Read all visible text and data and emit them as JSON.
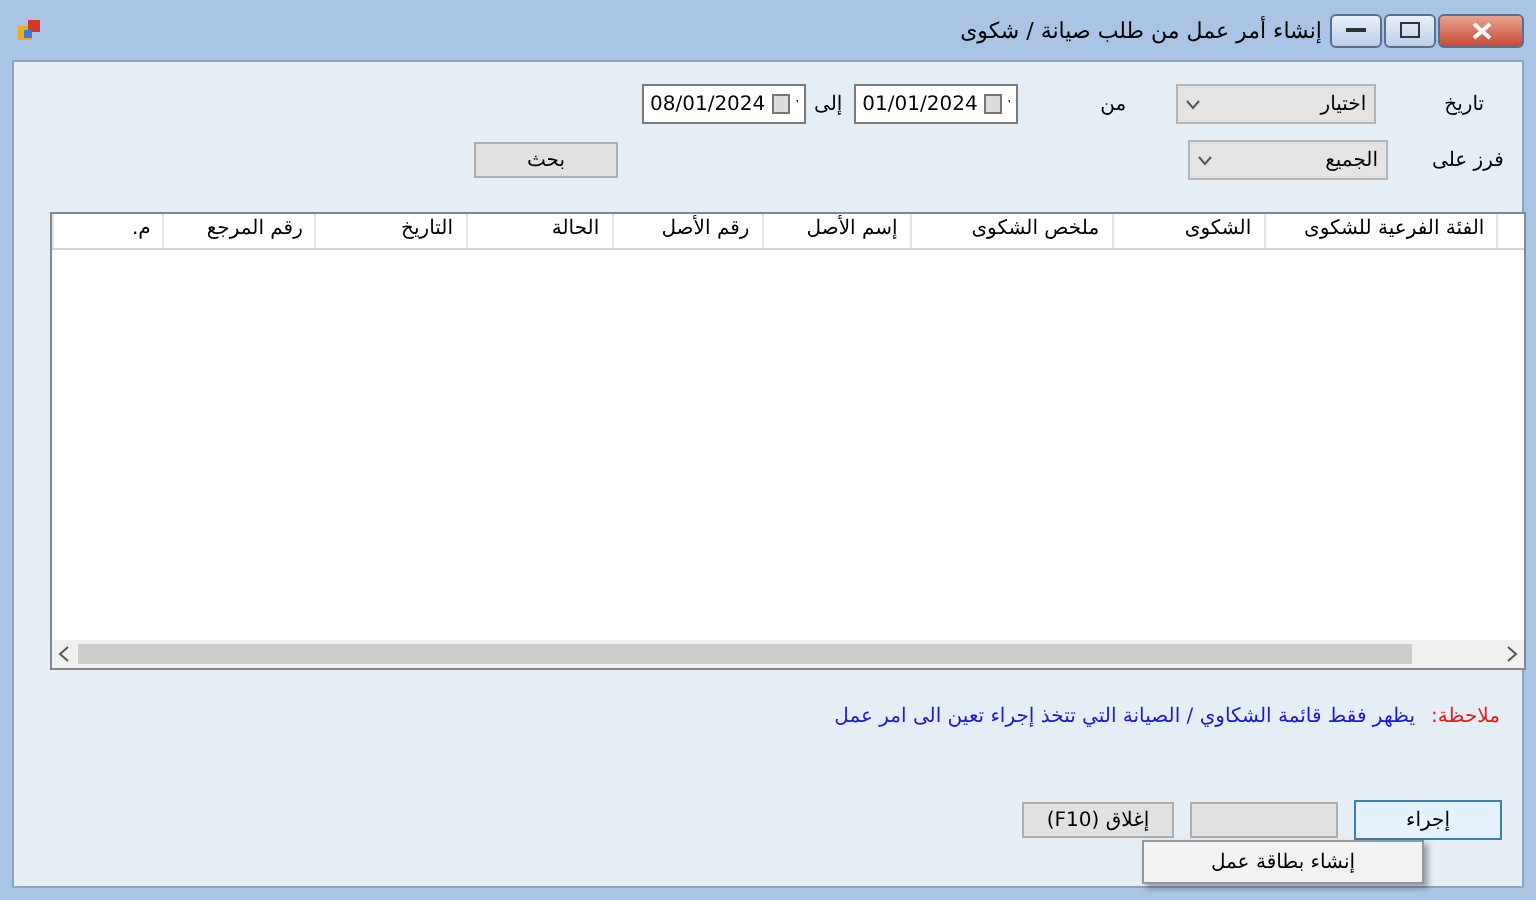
{
  "window": {
    "title": "إنشاء أمر عمل من طلب صيانة / شكوى"
  },
  "filters": {
    "date_label": "تاريخ",
    "date_choice": "اختيار",
    "from_label": "من",
    "from_date": "01/01/2024",
    "to_label": "إلى",
    "to_date": "08/01/2024",
    "sort_label": "فرز على",
    "sort_choice": "الجميع",
    "search_button": "بحث"
  },
  "table": {
    "columns": [
      "الفئة الفرعية للشكوى",
      "الشكوى",
      "ملخص الشكوى",
      "إسم الأصل",
      "رقم الأصل",
      "الحالة",
      "التاريخ",
      "رقم المرجع",
      "م."
    ]
  },
  "note": {
    "label": "ملاحظة:",
    "text": "يظهر فقط قائمة الشكاوي / الصيانة التي تتخذ إجراء تعين الى امر عمل"
  },
  "buttons": [
    {
      "label": "إجراء",
      "focused": true
    },
    {
      "focused": false
    },
    {
      "label": "إغلاق (F10)",
      "focused": false
    }
  ],
  "context_menu": {
    "items": [
      "إنشاء بطاقة عمل"
    ]
  }
}
